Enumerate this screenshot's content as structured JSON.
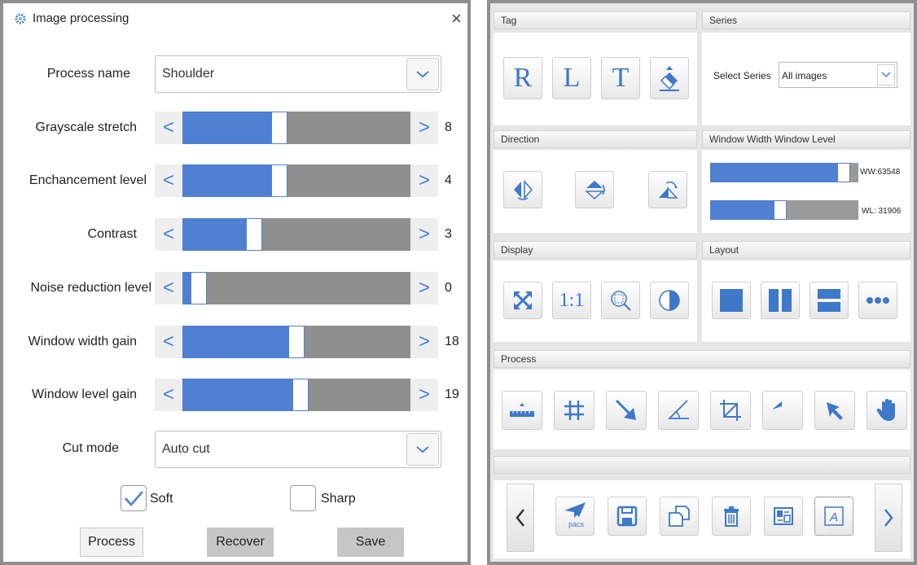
{
  "dialog": {
    "title": "Image processing",
    "close_glyph": "×",
    "process_name_label": "Process name",
    "process_name_value": "Shoulder",
    "sliders": [
      {
        "label": "Grayscale stretch",
        "value": "8",
        "level": 0.42
      },
      {
        "label": "Enchancement level",
        "value": "4",
        "level": 0.42
      },
      {
        "label": "Contrast",
        "value": "3",
        "level": 0.3
      },
      {
        "label": "Noise reduction level",
        "value": "0",
        "level": 0.04
      },
      {
        "label": "Window width gain",
        "value": "18",
        "level": 0.5
      },
      {
        "label": "Window level gain",
        "value": "19",
        "level": 0.52
      }
    ],
    "left_arrow": "<",
    "right_arrow": ">",
    "cut_mode_label": "Cut mode",
    "cut_mode_value": "Auto cut",
    "soft_label": "Soft",
    "soft_checked": true,
    "sharp_label": "Sharp",
    "sharp_checked": false,
    "process_btn": "Process",
    "recover_btn": "Recover",
    "save_btn": "Save",
    "accent_color": "#4f80d1"
  },
  "panel": {
    "tag_header": "Tag",
    "tag_buttons": [
      "R",
      "L",
      "T"
    ],
    "series_header": "Series",
    "select_series_label": "Select Series",
    "select_series_value": "All images",
    "direction_header": "Direction",
    "wwwl_header": "Window Width Window Level",
    "ww_label": "WW:63548",
    "ww_level": 0.94,
    "wl_label": "WL: 31906",
    "wl_level": 0.47,
    "display_header": "Display",
    "one_to_one": "1:1",
    "layout_header": "Layout",
    "process_header": "Process",
    "pacs_label": "pacs",
    "icons": {
      "tag": [
        "eraser-icon"
      ],
      "direction": [
        "flip-horizontal-icon",
        "flip-vertical-icon",
        "rotate-icon"
      ],
      "display": [
        "fit-screen-icon",
        "zoom-icon",
        "invert-icon"
      ],
      "layout": [
        "layout-1x1-icon",
        "layout-2-columns-icon",
        "layout-2-rows-icon",
        "layout-more-icon"
      ],
      "process": [
        "ruler-icon",
        "grid-icon",
        "arrow-icon",
        "angle-icon",
        "crop-icon",
        "undo-icon",
        "pointer-icon",
        "pan-hand-icon"
      ],
      "toolbar": [
        "prev-icon",
        "send-pacs-icon",
        "save-icon",
        "copy-icon",
        "delete-icon",
        "swap-icon",
        "text-annotation-icon",
        "next-icon"
      ]
    }
  }
}
